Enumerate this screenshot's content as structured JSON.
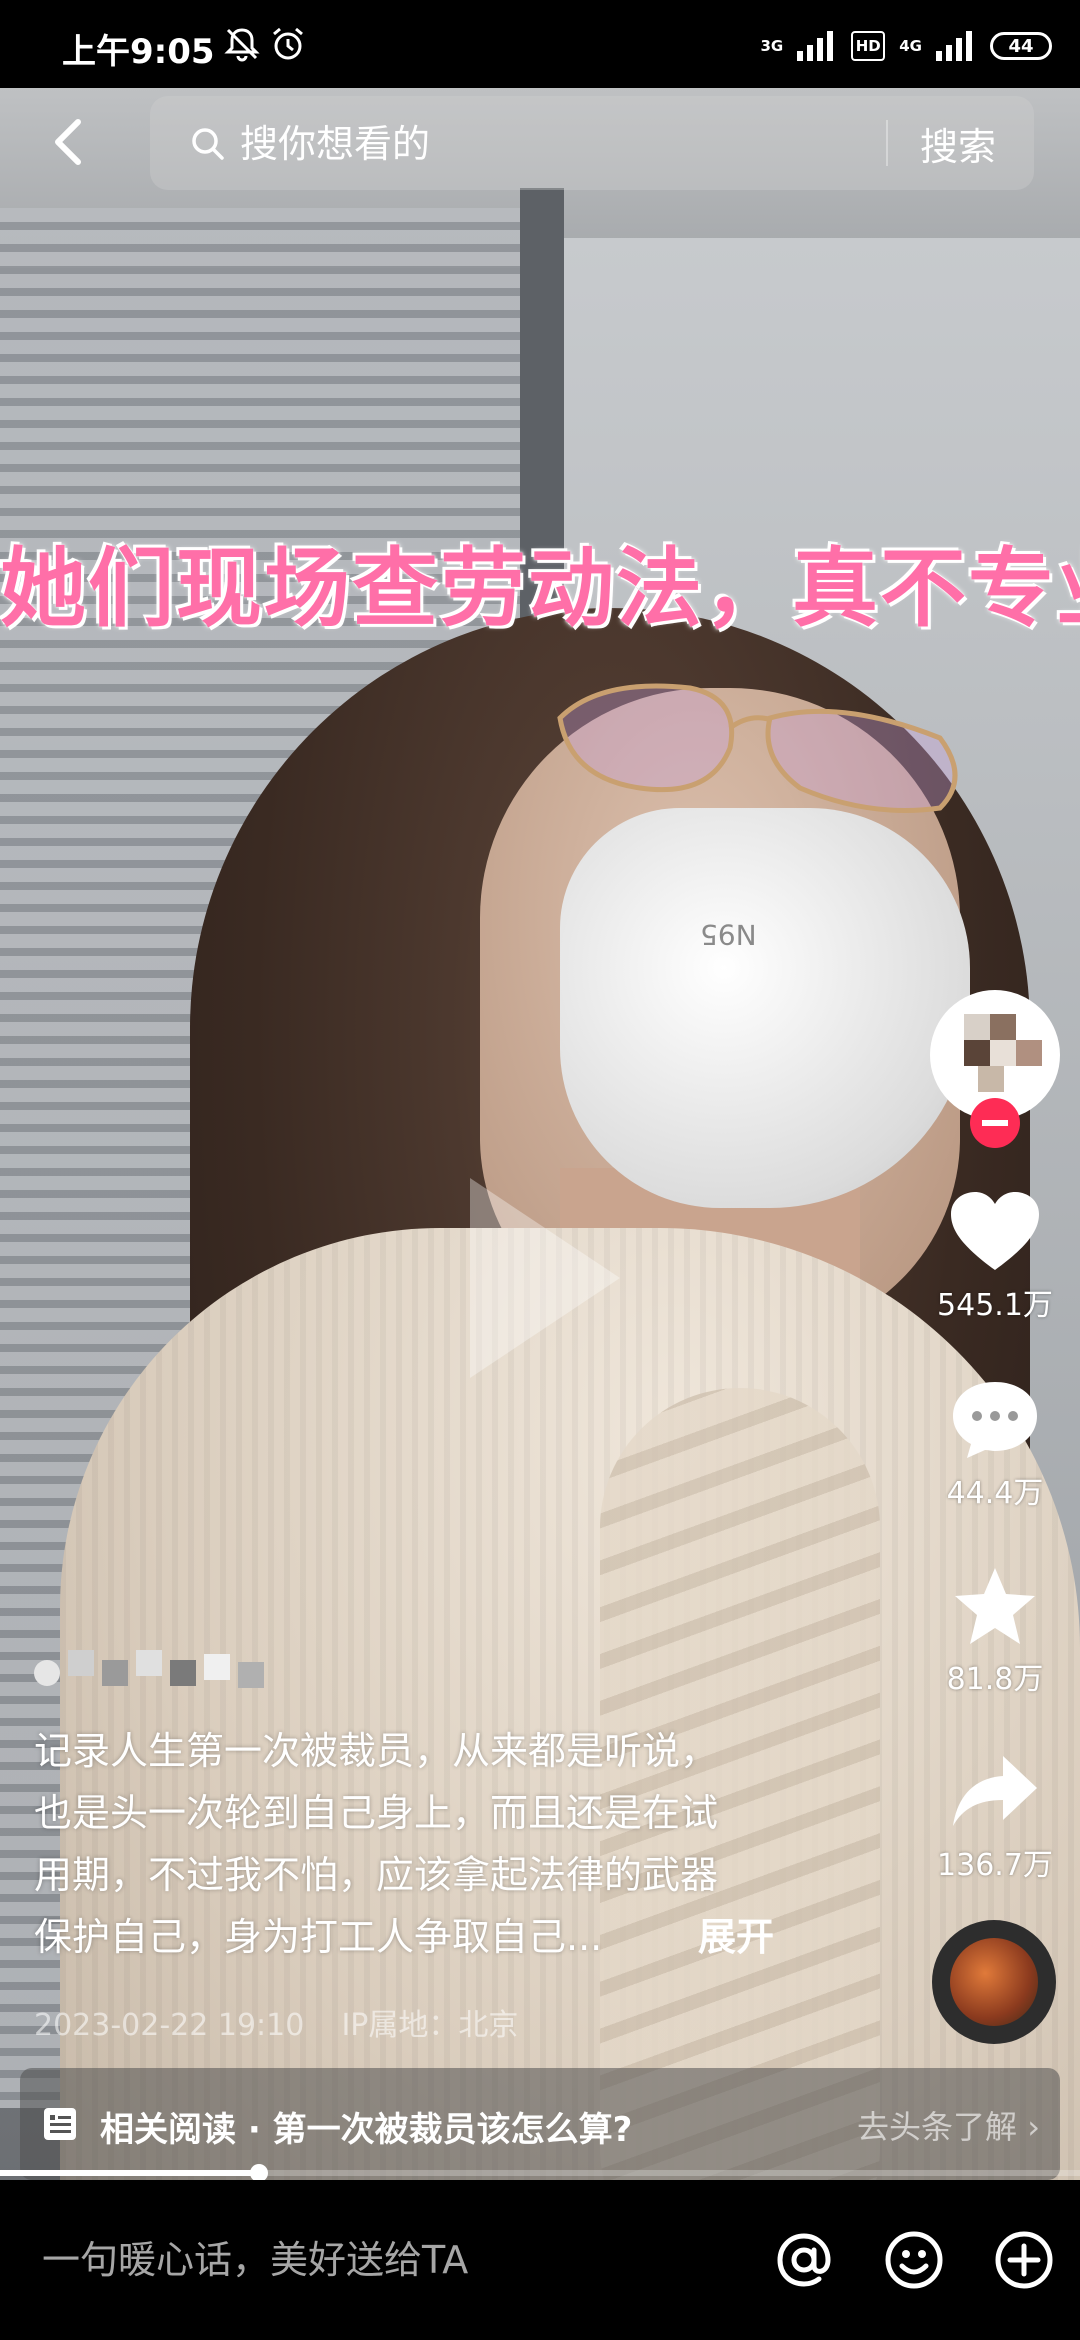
{
  "status_bar": {
    "time": "上午9:05",
    "net1": "3G",
    "hd": "HD",
    "net2": "4G",
    "battery": "44"
  },
  "search": {
    "placeholder": "搜你想看的",
    "button_label": "搜索"
  },
  "video": {
    "caption": "她们现场查劳动法，真不专业",
    "mask_text": "N95"
  },
  "actions": {
    "likes": "545.1万",
    "comments": "44.4万",
    "favorites": "81.8万",
    "shares": "136.7万"
  },
  "post": {
    "description_lines": [
      "记录人生第一次被裁员，从来都是听说，",
      "也是头一次轮到自己身上，而且还是在试",
      "用期，不过我不怕，应该拿起法律的武器",
      "保护自己，身为打工人争取自己..."
    ],
    "expand_label": "展开",
    "timestamp": "2023-02-22 19:10",
    "ip_location": "IP属地：北京"
  },
  "related": {
    "text": "相关阅读 · 第一次被裁员该怎么算?",
    "link": "去头条了解 ›"
  },
  "progress": {
    "played_fraction": 0.24
  },
  "comment_bar": {
    "placeholder": "一句暖心话，美好送给TA"
  },
  "colors": {
    "accent": "#fe2c55",
    "caption_pink": "#ff6fa8"
  },
  "icons": [
    "back-arrow-icon",
    "search-icon",
    "heart-icon",
    "comment-icon",
    "star-icon",
    "share-icon",
    "at-icon",
    "emoji-icon",
    "plus-icon",
    "article-icon",
    "mute-bell-icon",
    "alarm-icon"
  ]
}
